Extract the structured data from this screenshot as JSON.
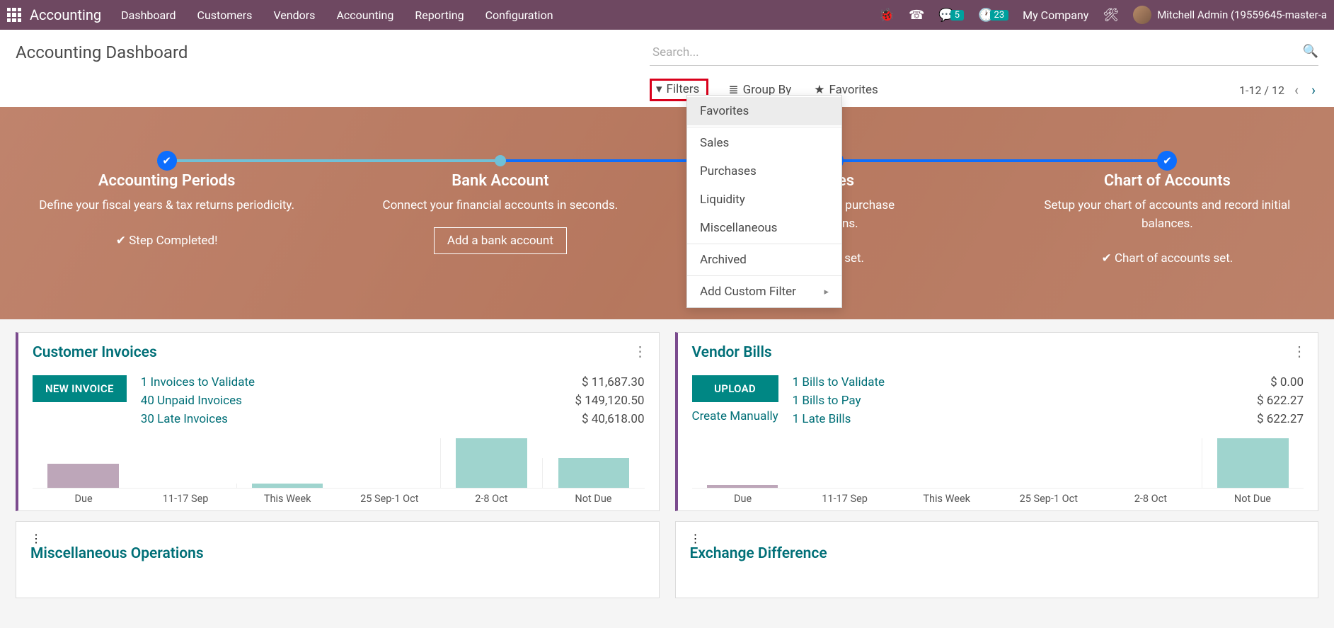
{
  "nav": {
    "brand": "Accounting",
    "menu": [
      "Dashboard",
      "Customers",
      "Vendors",
      "Accounting",
      "Reporting",
      "Configuration"
    ],
    "chat_badge": "5",
    "clock_badge": "23",
    "company": "My Company",
    "user": "Mitchell Admin (19559645-master-a"
  },
  "page_title": "Accounting Dashboard",
  "search_placeholder": "Search...",
  "controls": {
    "filters": "Filters",
    "groupby": "Group By",
    "favorites": "Favorites",
    "pager": "1-12 / 12"
  },
  "filter_dropdown": {
    "g1": [
      "Favorites"
    ],
    "g2": [
      "Sales",
      "Purchases",
      "Liquidity",
      "Miscellaneous"
    ],
    "g3": [
      "Archived"
    ],
    "g4": [
      "Add Custom Filter"
    ]
  },
  "hero_steps": [
    {
      "title": "Accounting Periods",
      "desc": "Define your fiscal years & tax returns periodicity.",
      "action": "Step Completed!",
      "type": "done",
      "dot": "check"
    },
    {
      "title": "Bank Account",
      "desc": "Connect your financial accounts in seconds.",
      "action": "Add a bank account",
      "type": "btn",
      "dot": "light"
    },
    {
      "title": "Taxes",
      "desc": "for sales and purchase\nsactions.",
      "action": "axes set.",
      "type": "done",
      "dot": "check"
    },
    {
      "title": "Chart of Accounts",
      "desc": "Setup your chart of accounts and record initial balances.",
      "action": "Chart of accounts set.",
      "type": "done",
      "dot": "check"
    }
  ],
  "cards": [
    {
      "title": "Customer Invoices",
      "primary_btn": "NEW INVOICE",
      "stats": [
        {
          "label": "1 Invoices to Validate",
          "val": "$ 11,687.30"
        },
        {
          "label": "40 Unpaid Invoices",
          "val": "$ 149,120.50"
        },
        {
          "label": "30 Late Invoices",
          "val": "$ 40,618.00"
        }
      ]
    },
    {
      "title": "Vendor Bills",
      "primary_btn": "UPLOAD",
      "secondary_link": "Create Manually",
      "stats": [
        {
          "label": "1 Bills to Validate",
          "val": "$ 0.00"
        },
        {
          "label": "1 Bills to Pay",
          "val": "$ 622.27"
        },
        {
          "label": "1 Late Bills",
          "val": "$ 622.27"
        }
      ]
    }
  ],
  "chart_data": [
    {
      "type": "bar",
      "categories": [
        "Due",
        "11-17 Sep",
        "This Week",
        "25 Sep-1 Oct",
        "2-8 Oct",
        "Not Due"
      ],
      "values": [
        24,
        0,
        4,
        0,
        50,
        30
      ],
      "colors": [
        "purple",
        "teal",
        "teal",
        "teal",
        "teal",
        "teal"
      ]
    },
    {
      "type": "bar",
      "categories": [
        "Due",
        "11-17 Sep",
        "This Week",
        "25 Sep-1 Oct",
        "2-8 Oct",
        "Not Due"
      ],
      "values": [
        3,
        0,
        0,
        0,
        0,
        50
      ],
      "colors": [
        "purple",
        "teal",
        "teal",
        "teal",
        "teal",
        "teal"
      ]
    }
  ],
  "cards2": [
    {
      "title": "Miscellaneous Operations"
    },
    {
      "title": "Exchange Difference"
    }
  ]
}
